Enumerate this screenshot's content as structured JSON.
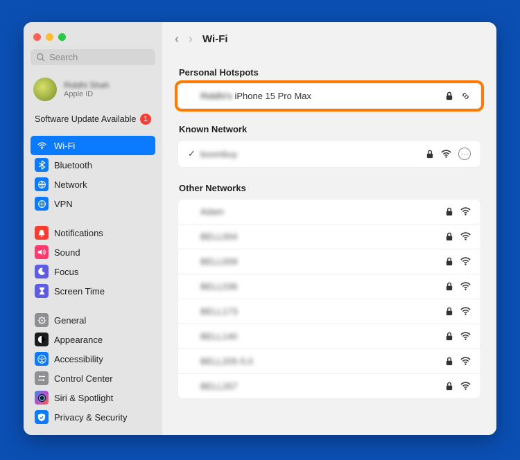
{
  "sidebar": {
    "search_placeholder": "Search",
    "account": {
      "name": "Riddhi Shah",
      "sub": "Apple ID"
    },
    "update": {
      "label": "Software Update Available",
      "count": "1"
    },
    "groups": [
      [
        {
          "key": "wifi",
          "label": "Wi-Fi",
          "color": "#0a7aff",
          "selected": true
        },
        {
          "key": "bluetooth",
          "label": "Bluetooth",
          "color": "#0a7aff"
        },
        {
          "key": "network",
          "label": "Network",
          "color": "#0a7aff"
        },
        {
          "key": "vpn",
          "label": "VPN",
          "color": "#0a7aff"
        }
      ],
      [
        {
          "key": "notifications",
          "label": "Notifications",
          "color": "#ff3b30"
        },
        {
          "key": "sound",
          "label": "Sound",
          "color": "#ff3b6e"
        },
        {
          "key": "focus",
          "label": "Focus",
          "color": "#5e5ce6"
        },
        {
          "key": "screentime",
          "label": "Screen Time",
          "color": "#5e5ce6"
        }
      ],
      [
        {
          "key": "general",
          "label": "General",
          "color": "#8e8e93"
        },
        {
          "key": "appearance",
          "label": "Appearance",
          "color": "#1c1c1e"
        },
        {
          "key": "accessibility",
          "label": "Accessibility",
          "color": "#0a7aff"
        },
        {
          "key": "controlcenter",
          "label": "Control Center",
          "color": "#8e8e93"
        },
        {
          "key": "siri",
          "label": "Siri & Spotlight",
          "color": "linear-gradient(135deg,#3a8dde,#b84fce,#ff5e3a)"
        },
        {
          "key": "privacy",
          "label": "Privacy & Security",
          "color": "#0a7aff"
        }
      ]
    ]
  },
  "main": {
    "title": "Wi-Fi",
    "sections": {
      "hotspots": {
        "header": "Personal Hotspots",
        "items": [
          {
            "prefix": "Riddhi's",
            "name": "iPhone 15 Pro Max",
            "lock": true,
            "hotspot": true
          }
        ]
      },
      "known": {
        "header": "Known Network",
        "items": [
          {
            "name": "boombuy",
            "connected": true,
            "lock": true,
            "wifi": true,
            "more": true
          }
        ]
      },
      "other": {
        "header": "Other Networks",
        "items": [
          {
            "name": "Adam",
            "lock": true,
            "wifi": true
          },
          {
            "name": "BELL004",
            "lock": true,
            "wifi": true
          },
          {
            "name": "BELL009",
            "lock": true,
            "wifi": true
          },
          {
            "name": "BELL036",
            "lock": true,
            "wifi": true
          },
          {
            "name": "BELL173",
            "lock": true,
            "wifi": true
          },
          {
            "name": "BELL140",
            "lock": true,
            "wifi": true
          },
          {
            "name": "BELL205-5.0",
            "lock": true,
            "wifi": true
          },
          {
            "name": "BELL267",
            "lock": true,
            "wifi": true
          }
        ]
      }
    }
  }
}
